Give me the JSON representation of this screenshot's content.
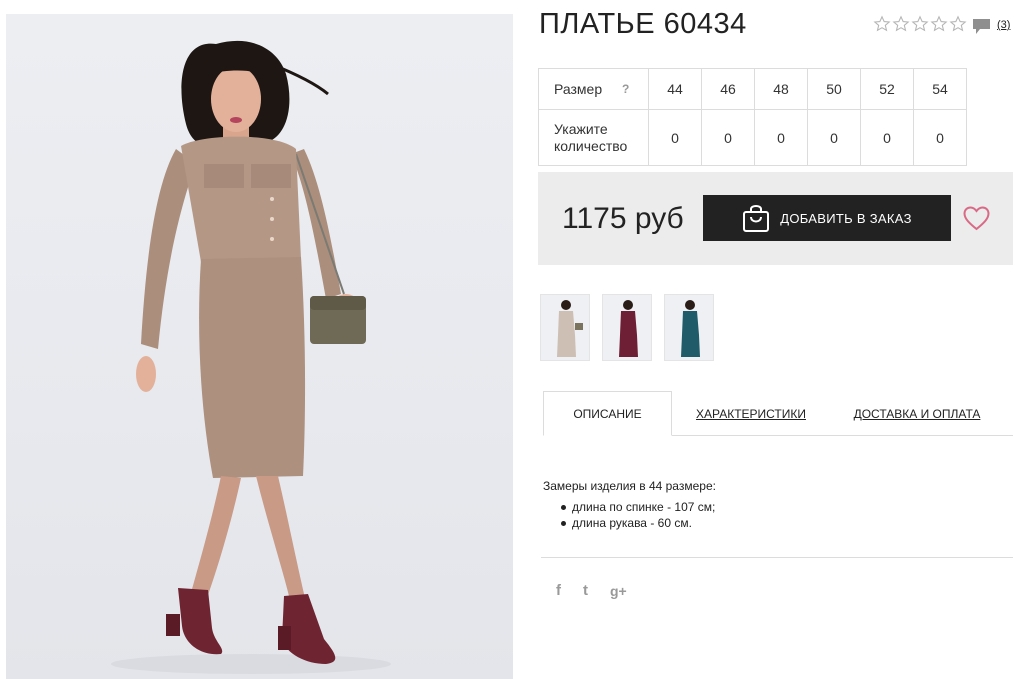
{
  "product": {
    "title": "ПЛАТЬЕ 60434",
    "reviews_count": "(3)",
    "rating_stars": 0,
    "rating_max": 5
  },
  "sizes": {
    "size_label": "Размер",
    "help_icon": "?",
    "quantity_label": "Укажите количество",
    "list": [
      {
        "size": "44",
        "qty": "0"
      },
      {
        "size": "46",
        "qty": "0"
      },
      {
        "size": "48",
        "qty": "0"
      },
      {
        "size": "50",
        "qty": "0"
      },
      {
        "size": "52",
        "qty": "0"
      },
      {
        "size": "54",
        "qty": "0"
      }
    ]
  },
  "purchase": {
    "price": "1175 руб",
    "add_button_label": "ДОБАВИТЬ В ЗАКАЗ"
  },
  "thumbnails": [
    {
      "name": "beige-dress",
      "color": "#cdbfb4"
    },
    {
      "name": "burgundy-dress",
      "color": "#6e1f35"
    },
    {
      "name": "teal-dress",
      "color": "#1f5b68"
    }
  ],
  "tabs": [
    {
      "label": "ОПИСАНИЕ",
      "active": true
    },
    {
      "label": "ХАРАКТЕРИСТИКИ",
      "active": false
    },
    {
      "label": "ДОСТАВКА И ОПЛАТА",
      "active": false
    }
  ],
  "description": {
    "lead": "Замеры изделия в 44 размере:",
    "items": [
      "длина по спинке - 107 см;",
      "длина рукава - 60 см."
    ]
  },
  "social": {
    "facebook": "f",
    "twitter": "t",
    "google_plus": "g+"
  },
  "colors": {
    "dark_button": "#222222",
    "price_bg": "#ececec",
    "heart": "#d96a86",
    "border": "#dcdcdc",
    "icon_grey": "#9a9a9a"
  }
}
